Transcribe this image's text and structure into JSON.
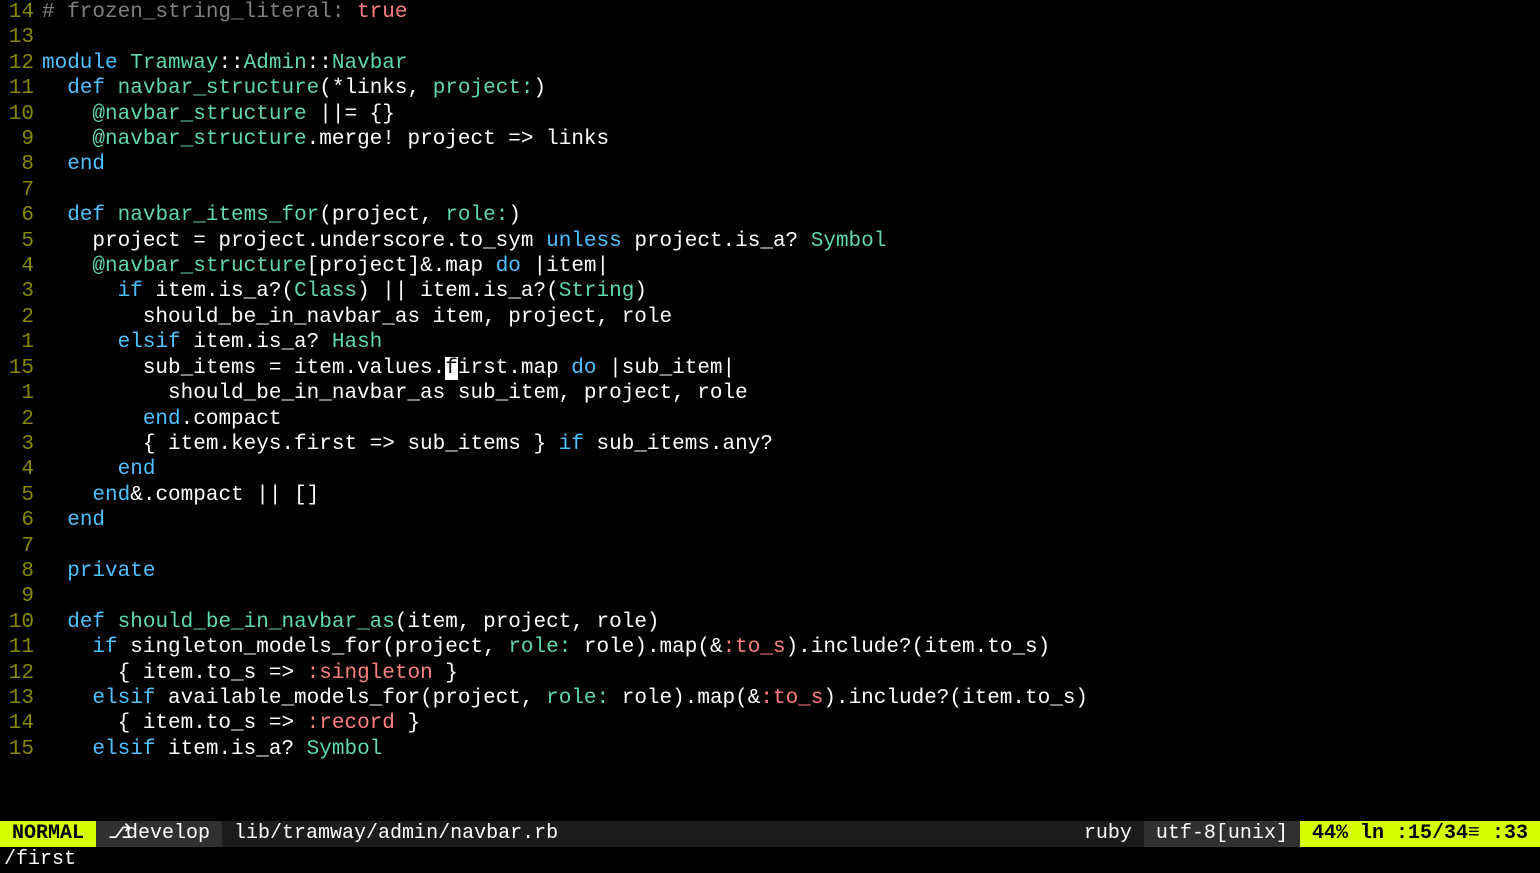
{
  "lines": [
    {
      "num": "14",
      "tokens": [
        {
          "t": "# frozen_string_literal: ",
          "c": "comment"
        },
        {
          "t": "true",
          "c": "bool"
        }
      ]
    },
    {
      "num": "13",
      "tokens": []
    },
    {
      "num": "12",
      "tokens": [
        {
          "t": "module ",
          "c": "kw"
        },
        {
          "t": "Tramway",
          "c": "type"
        },
        {
          "t": "::",
          "c": ""
        },
        {
          "t": "Admin",
          "c": "type"
        },
        {
          "t": "::",
          "c": ""
        },
        {
          "t": "Navbar",
          "c": "type"
        }
      ]
    },
    {
      "num": "11",
      "tokens": [
        {
          "t": "  ",
          "c": ""
        },
        {
          "t": "def ",
          "c": "def"
        },
        {
          "t": "navbar_structure",
          "c": "fn"
        },
        {
          "t": "(*links, ",
          "c": ""
        },
        {
          "t": "project:",
          "c": "param"
        },
        {
          "t": ")",
          "c": ""
        }
      ]
    },
    {
      "num": "10",
      "tokens": [
        {
          "t": "    ",
          "c": ""
        },
        {
          "t": "@navbar_structure",
          "c": "ivar"
        },
        {
          "t": " ||= {}",
          "c": ""
        }
      ]
    },
    {
      "num": "9",
      "tokens": [
        {
          "t": "    ",
          "c": ""
        },
        {
          "t": "@navbar_structure",
          "c": "ivar"
        },
        {
          "t": ".merge! project => links",
          "c": ""
        }
      ]
    },
    {
      "num": "8",
      "tokens": [
        {
          "t": "  ",
          "c": ""
        },
        {
          "t": "end",
          "c": "kw"
        }
      ]
    },
    {
      "num": "7",
      "tokens": []
    },
    {
      "num": "6",
      "tokens": [
        {
          "t": "  ",
          "c": ""
        },
        {
          "t": "def ",
          "c": "def"
        },
        {
          "t": "navbar_items_for",
          "c": "fn"
        },
        {
          "t": "(project, ",
          "c": ""
        },
        {
          "t": "role:",
          "c": "param"
        },
        {
          "t": ")",
          "c": ""
        }
      ]
    },
    {
      "num": "5",
      "tokens": [
        {
          "t": "    project = project.underscore.to_sym ",
          "c": ""
        },
        {
          "t": "unless",
          "c": "kw"
        },
        {
          "t": " project.is_a? ",
          "c": ""
        },
        {
          "t": "Symbol",
          "c": "type"
        }
      ]
    },
    {
      "num": "4",
      "tokens": [
        {
          "t": "    ",
          "c": ""
        },
        {
          "t": "@navbar_structure",
          "c": "ivar"
        },
        {
          "t": "[project]&.map ",
          "c": ""
        },
        {
          "t": "do",
          "c": "kw"
        },
        {
          "t": " |item|",
          "c": ""
        }
      ]
    },
    {
      "num": "3",
      "tokens": [
        {
          "t": "      ",
          "c": ""
        },
        {
          "t": "if",
          "c": "kw"
        },
        {
          "t": " item.is_a?(",
          "c": ""
        },
        {
          "t": "Class",
          "c": "type"
        },
        {
          "t": ") || item.is_a?(",
          "c": ""
        },
        {
          "t": "String",
          "c": "type"
        },
        {
          "t": ")",
          "c": ""
        }
      ]
    },
    {
      "num": "2",
      "tokens": [
        {
          "t": "        should_be_in_navbar_as item, project, role",
          "c": ""
        }
      ]
    },
    {
      "num": "1",
      "tokens": [
        {
          "t": "      ",
          "c": ""
        },
        {
          "t": "elsif",
          "c": "kw"
        },
        {
          "t": " item.is_a? ",
          "c": ""
        },
        {
          "t": "Hash",
          "c": "type"
        }
      ]
    },
    {
      "num": "15",
      "tokens": [
        {
          "t": "        sub_items = item.values.",
          "c": ""
        },
        {
          "t": "f",
          "c": "cursor"
        },
        {
          "t": "irst.map ",
          "c": ""
        },
        {
          "t": "do",
          "c": "kw"
        },
        {
          "t": " |sub_item|",
          "c": ""
        }
      ]
    },
    {
      "num": "1",
      "tokens": [
        {
          "t": "          should_be_in_navbar_as sub_item, project, role",
          "c": ""
        }
      ]
    },
    {
      "num": "2",
      "tokens": [
        {
          "t": "        ",
          "c": ""
        },
        {
          "t": "end",
          "c": "kw"
        },
        {
          "t": ".compact",
          "c": ""
        }
      ]
    },
    {
      "num": "3",
      "tokens": [
        {
          "t": "        { item.keys.first => sub_items } ",
          "c": ""
        },
        {
          "t": "if",
          "c": "kw"
        },
        {
          "t": " sub_items.any?",
          "c": ""
        }
      ]
    },
    {
      "num": "4",
      "tokens": [
        {
          "t": "      ",
          "c": ""
        },
        {
          "t": "end",
          "c": "kw"
        }
      ]
    },
    {
      "num": "5",
      "tokens": [
        {
          "t": "    ",
          "c": ""
        },
        {
          "t": "end",
          "c": "kw"
        },
        {
          "t": "&.compact || []",
          "c": ""
        }
      ]
    },
    {
      "num": "6",
      "tokens": [
        {
          "t": "  ",
          "c": ""
        },
        {
          "t": "end",
          "c": "kw"
        }
      ]
    },
    {
      "num": "7",
      "tokens": []
    },
    {
      "num": "8",
      "tokens": [
        {
          "t": "  ",
          "c": ""
        },
        {
          "t": "private",
          "c": "kw"
        }
      ]
    },
    {
      "num": "9",
      "tokens": []
    },
    {
      "num": "10",
      "tokens": [
        {
          "t": "  ",
          "c": ""
        },
        {
          "t": "def ",
          "c": "def"
        },
        {
          "t": "should_be_in_navbar_as",
          "c": "fn"
        },
        {
          "t": "(item, project, role)",
          "c": ""
        }
      ]
    },
    {
      "num": "11",
      "tokens": [
        {
          "t": "    ",
          "c": ""
        },
        {
          "t": "if",
          "c": "kw"
        },
        {
          "t": " singleton_models_for(project, ",
          "c": ""
        },
        {
          "t": "role:",
          "c": "param"
        },
        {
          "t": " role).map(&",
          "c": ""
        },
        {
          "t": ":to_s",
          "c": "sym"
        },
        {
          "t": ").include?(item.to_s)",
          "c": ""
        }
      ]
    },
    {
      "num": "12",
      "tokens": [
        {
          "t": "      { item.to_s => ",
          "c": ""
        },
        {
          "t": ":singleton",
          "c": "sym"
        },
        {
          "t": " }",
          "c": ""
        }
      ]
    },
    {
      "num": "13",
      "tokens": [
        {
          "t": "    ",
          "c": ""
        },
        {
          "t": "elsif",
          "c": "kw"
        },
        {
          "t": " available_models_for(project, ",
          "c": ""
        },
        {
          "t": "role:",
          "c": "param"
        },
        {
          "t": " role).map(&",
          "c": ""
        },
        {
          "t": ":to_s",
          "c": "sym"
        },
        {
          "t": ").include?(item.to_s)",
          "c": ""
        }
      ]
    },
    {
      "num": "14",
      "tokens": [
        {
          "t": "      { item.to_s => ",
          "c": ""
        },
        {
          "t": ":record",
          "c": "sym"
        },
        {
          "t": " }",
          "c": ""
        }
      ]
    },
    {
      "num": "15",
      "tokens": [
        {
          "t": "    ",
          "c": ""
        },
        {
          "t": "elsif",
          "c": "kw"
        },
        {
          "t": " item.is_a? ",
          "c": ""
        },
        {
          "t": "Symbol",
          "c": "type"
        }
      ]
    }
  ],
  "status": {
    "mode": "NORMAL",
    "branch_icon": "⎇",
    "branch": "develop",
    "file": "lib/tramway/admin/navbar.rb",
    "filetype": "ruby",
    "encoding": "utf-8[unix]",
    "position": "44% ln :15/34≡ :33"
  },
  "command": "/first"
}
